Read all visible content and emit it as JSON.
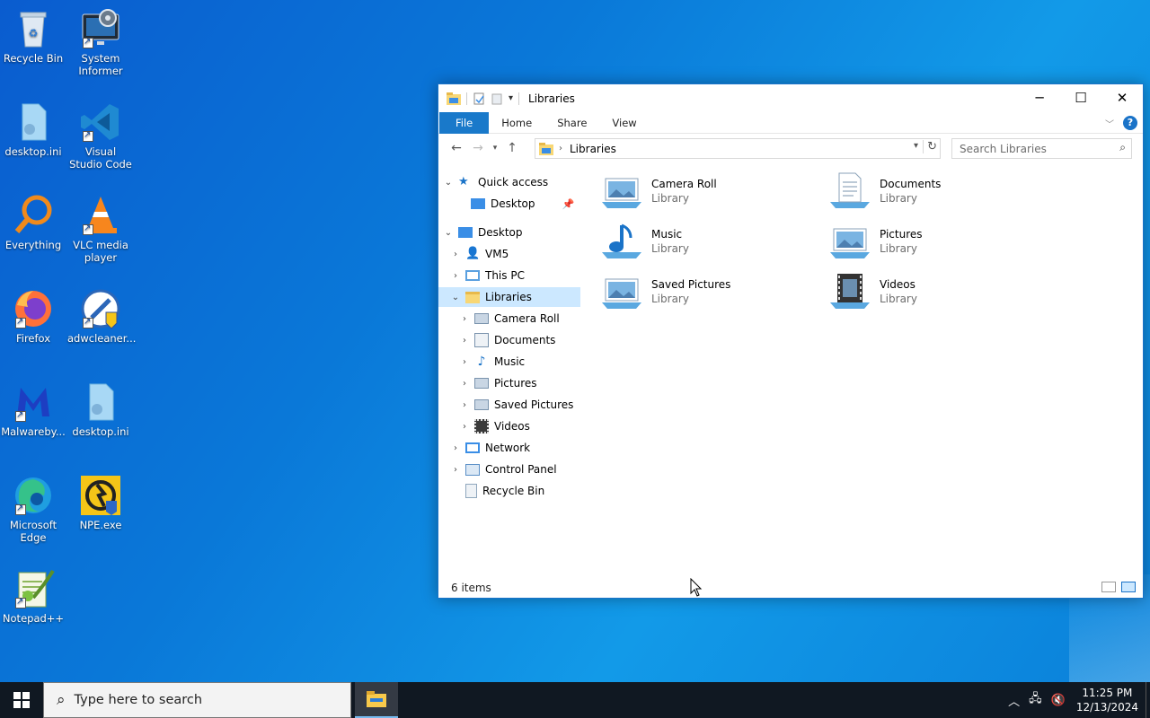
{
  "desktop": {
    "icons": [
      {
        "label": "Recycle Bin",
        "icon": "recycle-bin-icon"
      },
      {
        "label": "System Informer",
        "icon": "system-informer-icon"
      },
      {
        "label": "desktop.ini",
        "icon": "ini-file-icon"
      },
      {
        "label": "Visual Studio Code",
        "icon": "vscode-icon"
      },
      {
        "label": "Everything",
        "icon": "everything-search-icon"
      },
      {
        "label": "VLC media player",
        "icon": "vlc-icon"
      },
      {
        "label": "Firefox",
        "icon": "firefox-icon"
      },
      {
        "label": "adwcleaner...",
        "icon": "adwcleaner-icon"
      },
      {
        "label": "Malwareby...",
        "icon": "malwarebytes-icon"
      },
      {
        "label": "desktop.ini",
        "icon": "ini-file-icon"
      },
      {
        "label": "Microsoft Edge",
        "icon": "edge-icon"
      },
      {
        "label": "NPE.exe",
        "icon": "npe-icon"
      },
      {
        "label": "Notepad++",
        "icon": "notepadpp-icon"
      }
    ]
  },
  "window": {
    "title": "Libraries",
    "controls": {
      "minimize": "─",
      "maximize": "☐",
      "close": "✕"
    },
    "ribbon": {
      "tabs": [
        "File",
        "Home",
        "Share",
        "View"
      ],
      "help": "?"
    },
    "address": {
      "path": "Libraries",
      "search_placeholder": "Search Libraries"
    },
    "nav": {
      "quick_access": "Quick access",
      "desktop_pinned": "Desktop",
      "desktop": "Desktop",
      "vm5": "VM5",
      "this_pc": "This PC",
      "libraries": "Libraries",
      "camera_roll": "Camera Roll",
      "documents": "Documents",
      "music": "Music",
      "pictures": "Pictures",
      "saved_pictures": "Saved Pictures",
      "videos": "Videos",
      "network": "Network",
      "control_panel": "Control Panel",
      "recycle_bin": "Recycle Bin"
    },
    "libraries": [
      {
        "name": "Camera Roll",
        "type": "Library",
        "icon": "camera-roll-library-icon"
      },
      {
        "name": "Documents",
        "type": "Library",
        "icon": "documents-library-icon"
      },
      {
        "name": "Music",
        "type": "Library",
        "icon": "music-library-icon"
      },
      {
        "name": "Pictures",
        "type": "Library",
        "icon": "pictures-library-icon"
      },
      {
        "name": "Saved Pictures",
        "type": "Library",
        "icon": "saved-pictures-library-icon"
      },
      {
        "name": "Videos",
        "type": "Library",
        "icon": "videos-library-icon"
      }
    ],
    "status": "6 items"
  },
  "taskbar": {
    "search_placeholder": "Type here to search",
    "time": "11:25 PM",
    "date": "12/13/2024"
  },
  "colors": {
    "accent": "#1979ca",
    "selection": "#cce8ff",
    "taskbar": "#101822"
  }
}
